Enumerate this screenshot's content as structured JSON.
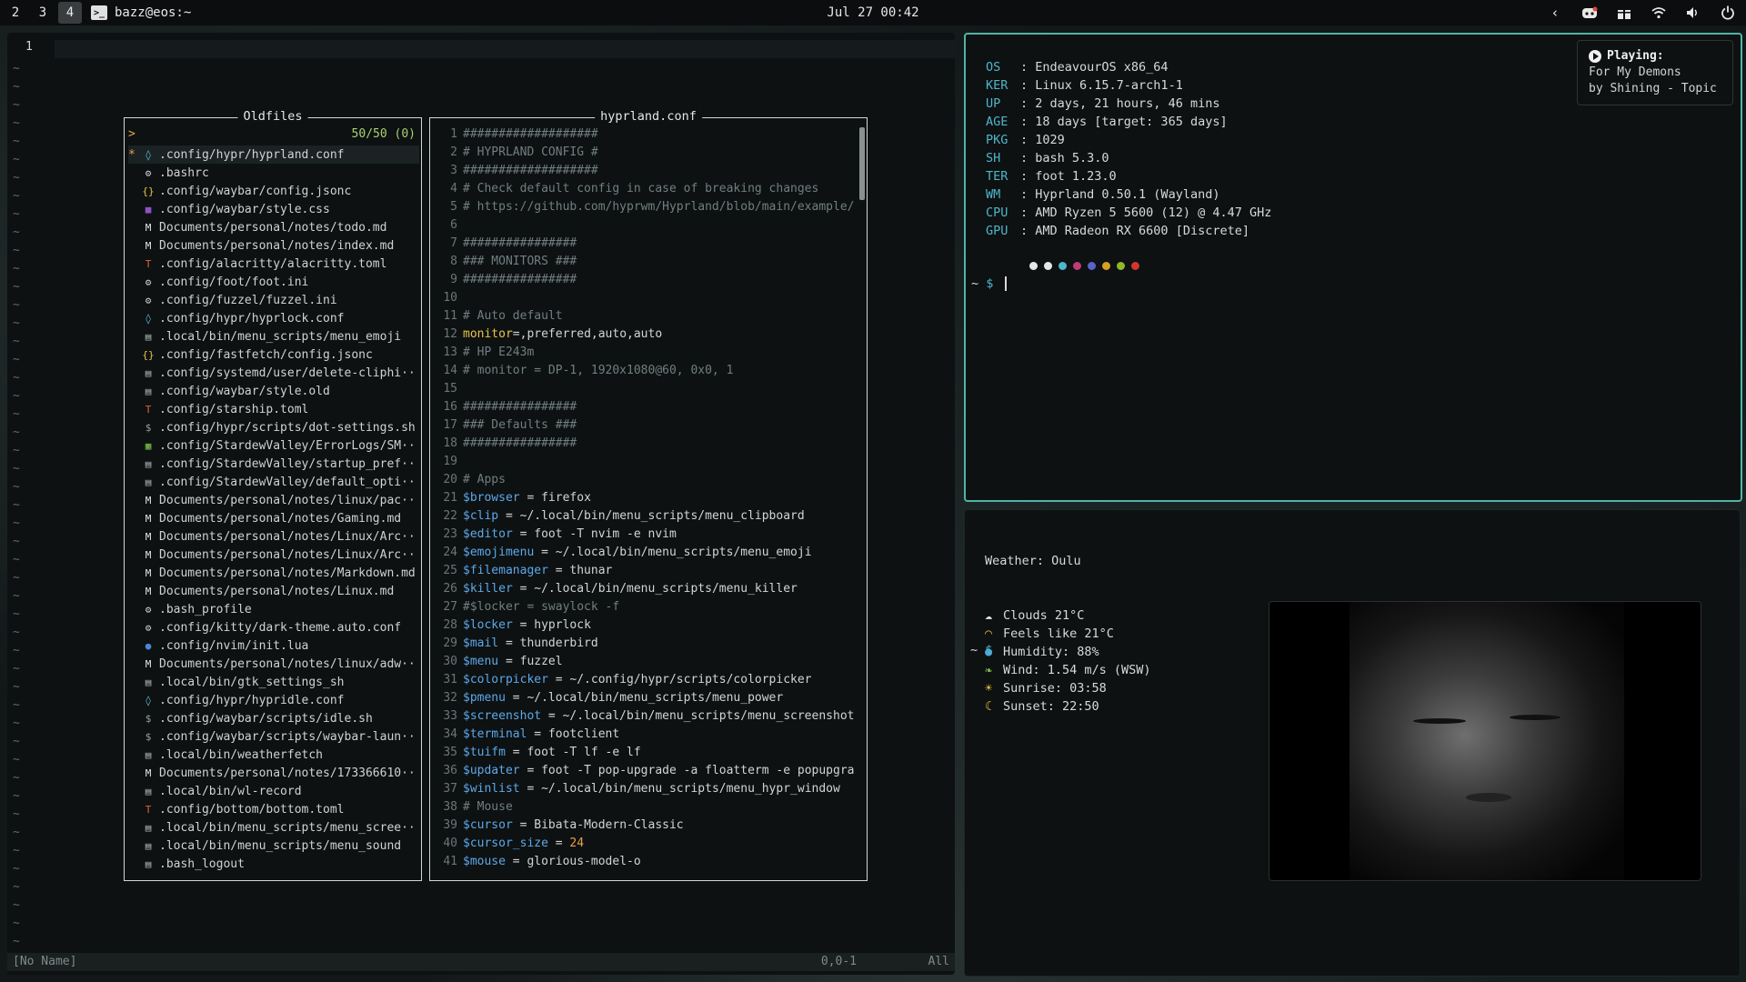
{
  "topbar": {
    "workspaces": [
      "2",
      "3",
      "4"
    ],
    "active_workspace": "4",
    "window_title": "bazz@eos:~",
    "clock": "Jul 27 00:42",
    "tray_icons": [
      "chevron-left-icon",
      "discord-icon",
      "gift-icon",
      "wifi-icon",
      "volume-icon",
      "power-icon"
    ]
  },
  "editor": {
    "line_number": "1",
    "status_name": "[No Name]",
    "status_pos": "0,0-1",
    "status_all": "All",
    "oldfiles": {
      "title": "Oldfiles",
      "prompt": ">",
      "count": "50/50 (0)",
      "selected_index": 0,
      "files": [
        {
          "icon": "hypr-icon",
          "path": ".config/hypr/hyprland.conf"
        },
        {
          "icon": "gear-icon",
          "path": ".bashrc"
        },
        {
          "icon": "json-icon",
          "path": ".config/waybar/config.jsonc"
        },
        {
          "icon": "css-icon",
          "path": ".config/waybar/style.css"
        },
        {
          "icon": "markdown-icon",
          "path": "Documents/personal/notes/todo.md"
        },
        {
          "icon": "markdown-icon",
          "path": "Documents/personal/notes/index.md"
        },
        {
          "icon": "toml-icon",
          "path": ".config/alacritty/alacritty.toml"
        },
        {
          "icon": "gear-icon",
          "path": ".config/foot/foot.ini"
        },
        {
          "icon": "gear-icon",
          "path": ".config/fuzzel/fuzzel.ini"
        },
        {
          "icon": "hypr-icon",
          "path": ".config/hypr/hyprlock.conf"
        },
        {
          "icon": "file-icon",
          "path": ".local/bin/menu_scripts/menu_emoji"
        },
        {
          "icon": "json-icon",
          "path": ".config/fastfetch/config.jsonc"
        },
        {
          "icon": "file-icon",
          "path": ".config/systemd/user/delete-cliphi··"
        },
        {
          "icon": "file-icon",
          "path": ".config/waybar/style.old"
        },
        {
          "icon": "toml-icon",
          "path": ".config/starship.toml"
        },
        {
          "icon": "shell-icon",
          "path": ".config/hypr/scripts/dot-settings.sh"
        },
        {
          "icon": "log-icon",
          "path": ".config/StardewValley/ErrorLogs/SM··"
        },
        {
          "icon": "file-icon",
          "path": ".config/StardewValley/startup_pref··"
        },
        {
          "icon": "file-icon",
          "path": ".config/StardewValley/default_opti··"
        },
        {
          "icon": "markdown-icon",
          "path": "Documents/personal/notes/linux/pac··"
        },
        {
          "icon": "markdown-icon",
          "path": "Documents/personal/notes/Gaming.md"
        },
        {
          "icon": "markdown-icon",
          "path": "Documents/personal/notes/Linux/Arc··"
        },
        {
          "icon": "markdown-icon",
          "path": "Documents/personal/notes/Linux/Arc··"
        },
        {
          "icon": "markdown-icon",
          "path": "Documents/personal/notes/Markdown.md"
        },
        {
          "icon": "markdown-icon",
          "path": "Documents/personal/notes/Linux.md"
        },
        {
          "icon": "gear-icon",
          "path": ".bash_profile"
        },
        {
          "icon": "gear-icon",
          "path": ".config/kitty/dark-theme.auto.conf"
        },
        {
          "icon": "lua-icon",
          "path": ".config/nvim/init.lua"
        },
        {
          "icon": "markdown-icon",
          "path": "Documents/personal/notes/linux/adw··"
        },
        {
          "icon": "file-icon",
          "path": ".local/bin/gtk_settings_sh"
        },
        {
          "icon": "hypr-icon",
          "path": ".config/hypr/hypridle.conf"
        },
        {
          "icon": "shell-icon",
          "path": ".config/waybar/scripts/idle.sh"
        },
        {
          "icon": "shell-icon",
          "path": ".config/waybar/scripts/waybar-laun··"
        },
        {
          "icon": "file-icon",
          "path": ".local/bin/weatherfetch"
        },
        {
          "icon": "markdown-icon",
          "path": "Documents/personal/notes/173366610··"
        },
        {
          "icon": "file-icon",
          "path": ".local/bin/wl-record"
        },
        {
          "icon": "toml-icon",
          "path": ".config/bottom/bottom.toml"
        },
        {
          "icon": "file-icon",
          "path": ".local/bin/menu_scripts/menu_scree··"
        },
        {
          "icon": "file-icon",
          "path": ".local/bin/menu_scripts/menu_sound"
        },
        {
          "icon": "file-icon",
          "path": ".bash_logout"
        }
      ]
    },
    "preview": {
      "title": "hyprland.conf",
      "lines": [
        [
          [
            "cm",
            "###################"
          ]
        ],
        [
          [
            "cm",
            "# HYPRLAND CONFIG #"
          ]
        ],
        [
          [
            "cm",
            "###################"
          ]
        ],
        [
          [
            "cm",
            "# Check default config in case of breaking changes"
          ]
        ],
        [
          [
            "cm",
            "# https://github.com/hyprwm/Hyprland/blob/main/example/"
          ]
        ],
        [],
        [
          [
            "cm",
            "################"
          ]
        ],
        [
          [
            "cm",
            "### MONITORS ###"
          ]
        ],
        [
          [
            "cm",
            "################"
          ]
        ],
        [],
        [
          [
            "cm",
            "# Auto default"
          ]
        ],
        [
          [
            "kw",
            "monitor"
          ],
          [
            "",
            "=,preferred,auto,auto"
          ]
        ],
        [
          [
            "cm",
            "# HP E243m"
          ]
        ],
        [
          [
            "cm",
            "# monitor = DP-1, 1920x1080@60, 0x0, 1"
          ]
        ],
        [],
        [
          [
            "cm",
            "################"
          ]
        ],
        [
          [
            "cm",
            "### Defaults ###"
          ]
        ],
        [
          [
            "cm",
            "################"
          ]
        ],
        [],
        [
          [
            "cm",
            "# Apps"
          ]
        ],
        [
          [
            "vr",
            "$browser"
          ],
          [
            "",
            " = firefox"
          ]
        ],
        [
          [
            "vr",
            "$clip"
          ],
          [
            "",
            " = ~/.local/bin/menu_scripts/menu_clipboard"
          ]
        ],
        [
          [
            "vr",
            "$editor"
          ],
          [
            "",
            " = foot -T nvim -e nvim"
          ]
        ],
        [
          [
            "vr",
            "$emojimenu"
          ],
          [
            "",
            " = ~/.local/bin/menu_scripts/menu_emoji"
          ]
        ],
        [
          [
            "vr",
            "$filemanager"
          ],
          [
            "",
            " = thunar"
          ]
        ],
        [
          [
            "vr",
            "$killer"
          ],
          [
            "",
            " = ~/.local/bin/menu_scripts/menu_killer"
          ]
        ],
        [
          [
            "cm",
            "#$locker = swaylock -f"
          ]
        ],
        [
          [
            "vr",
            "$locker"
          ],
          [
            "",
            " = hyprlock"
          ]
        ],
        [
          [
            "vr",
            "$mail"
          ],
          [
            "",
            " = thunderbird"
          ]
        ],
        [
          [
            "vr",
            "$menu"
          ],
          [
            "",
            " = fuzzel"
          ]
        ],
        [
          [
            "vr",
            "$colorpicker"
          ],
          [
            "",
            " = ~/.config/hypr/scripts/colorpicker"
          ]
        ],
        [
          [
            "vr",
            "$pmenu"
          ],
          [
            "",
            " = ~/.local/bin/menu_scripts/menu_power"
          ]
        ],
        [
          [
            "vr",
            "$screenshot"
          ],
          [
            "",
            " = ~/.local/bin/menu_scripts/menu_screenshot"
          ]
        ],
        [
          [
            "vr",
            "$terminal"
          ],
          [
            "",
            " = footclient"
          ]
        ],
        [
          [
            "vr",
            "$tuifm"
          ],
          [
            "",
            " = foot -T lf -e lf"
          ]
        ],
        [
          [
            "vr",
            "$updater"
          ],
          [
            "",
            " = foot -T pop-upgrade -a floatterm -e popupgra"
          ]
        ],
        [
          [
            "vr",
            "$winlist"
          ],
          [
            "",
            " = ~/.local/bin/menu_scripts/menu_hypr_window"
          ]
        ],
        [
          [
            "cm",
            "# Mouse"
          ]
        ],
        [
          [
            "vr",
            "$cursor"
          ],
          [
            "",
            " = Bibata-Modern-Classic"
          ]
        ],
        [
          [
            "vr",
            "$cursor_size"
          ],
          [
            "",
            " = "
          ],
          [
            "num",
            "24"
          ]
        ],
        [
          [
            "vr",
            "$mouse"
          ],
          [
            "",
            " = glorious-model-o"
          ]
        ]
      ]
    }
  },
  "fastfetch": {
    "rows": [
      {
        "key": "OS",
        "value": "EndeavourOS x86_64"
      },
      {
        "key": "KER",
        "value": "Linux 6.15.7-arch1-1"
      },
      {
        "key": "UP",
        "value": "2 days, 21 hours, 46 mins"
      },
      {
        "key": "AGE",
        "value": "18 days [target: 365 days]"
      },
      {
        "key": "PKG",
        "value": "1029"
      },
      {
        "key": "SH",
        "value": "bash 5.3.0"
      },
      {
        "key": "TER",
        "value": "foot 1.23.0"
      },
      {
        "key": "WM",
        "value": "Hyprland 0.50.1 (Wayland)"
      },
      {
        "key": "CPU",
        "value": "AMD Ryzen 5 5600 (12) @ 4.47 GHz"
      },
      {
        "key": "GPU",
        "value": "AMD Radeon RX 6600 [Discrete]"
      }
    ],
    "palette": [
      "#e6e6e6",
      "#e6e6e6",
      "#4fb6c9",
      "#c0397a",
      "#5a62c8",
      "#d8a022",
      "#8fb82b",
      "#d0362c"
    ],
    "prompt_tilde": "~",
    "prompt_dollar": "$"
  },
  "nowplaying": {
    "label": "Playing:",
    "track": "For My Demons",
    "artist": "by Shining - Topic"
  },
  "weather": {
    "title": "Weather: Oulu",
    "rows": [
      {
        "icon": "cloud-icon",
        "glyph": "☁",
        "color": "#e6e6e6",
        "text": "Clouds 21°C"
      },
      {
        "icon": "rainbow-icon",
        "glyph": "◠",
        "color": "#e9a246",
        "text": "Feels like 21°C"
      },
      {
        "icon": "droplet-icon",
        "glyph": "●",
        "color": "#4aa3e0",
        "text": "Humidity: 88%"
      },
      {
        "icon": "leaf-icon",
        "glyph": "❧",
        "color": "#7cc04a",
        "text": "Wind: 1.54 m/s (WSW)"
      },
      {
        "icon": "sun-icon",
        "glyph": "☀",
        "color": "#f0c23a",
        "text": "Sunrise: 03:58"
      },
      {
        "icon": "moon-icon",
        "glyph": "☾",
        "color": "#f0c23a",
        "text": "Sunset: 22:50"
      }
    ],
    "prompt_tilde": "~",
    "prompt_dollar": "$"
  }
}
